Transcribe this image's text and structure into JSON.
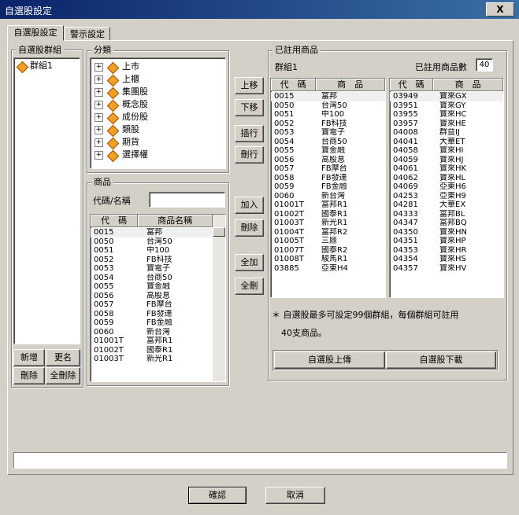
{
  "window": {
    "title": "自選股設定",
    "close": "X"
  },
  "tabs": [
    {
      "label": "自選股設定"
    },
    {
      "label": "警示設定"
    }
  ],
  "groups_panel": {
    "label": "自選股群組",
    "items": [
      "群組1"
    ],
    "buttons": {
      "add": "新增",
      "rename": "更名",
      "delete": "刪除",
      "delete_all": "全刪除"
    }
  },
  "category_panel": {
    "label": "分類",
    "items": [
      "上市",
      "上櫃",
      "集團股",
      "概念股",
      "成份股",
      "類股",
      "期貨",
      "選擇權"
    ]
  },
  "product_panel": {
    "label": "商品",
    "search_label": "代碼/名稱",
    "search_value": "",
    "columns": [
      "代　碼",
      "商品名稱"
    ],
    "rows": [
      [
        "0015",
        "富邦"
      ],
      [
        "0050",
        "台灣50"
      ],
      [
        "0051",
        "中100"
      ],
      [
        "0052",
        "FB科技"
      ],
      [
        "0053",
        "寶電子"
      ],
      [
        "0054",
        "台商50"
      ],
      [
        "0055",
        "寶金融"
      ],
      [
        "0056",
        "高股息"
      ],
      [
        "0057",
        "FB摩台"
      ],
      [
        "0058",
        "FB發達"
      ],
      [
        "0059",
        "FB金融"
      ],
      [
        "0060",
        "新台灣"
      ],
      [
        "01001T",
        "富邦R1"
      ],
      [
        "01002T",
        "國泰R1"
      ],
      [
        "01003T",
        "新光R1"
      ]
    ]
  },
  "middle_buttons": {
    "up": "上移",
    "down": "下移",
    "insert": "插行",
    "delete_row": "刪行",
    "add": "加入",
    "remove": "刪除",
    "add_all": "全加",
    "remove_all": "全刪"
  },
  "used_panel": {
    "label": "已註用商品",
    "group_name": "群組1",
    "count_label": "已註用商品數",
    "count": "40",
    "columns": [
      "代　碼",
      "商　品"
    ],
    "left_rows": [
      [
        "0015",
        "富邦"
      ],
      [
        "0050",
        "台灣50"
      ],
      [
        "0051",
        "中100"
      ],
      [
        "0052",
        "FB科技"
      ],
      [
        "0053",
        "寶電子"
      ],
      [
        "0054",
        "台商50"
      ],
      [
        "0055",
        "寶金融"
      ],
      [
        "0056",
        "高股息"
      ],
      [
        "0057",
        "FB摩台"
      ],
      [
        "0058",
        "FB發達"
      ],
      [
        "0059",
        "FB金融"
      ],
      [
        "0060",
        "新台灣"
      ],
      [
        "01001T",
        "富邦R1"
      ],
      [
        "01002T",
        "國泰R1"
      ],
      [
        "01003T",
        "新光R1"
      ],
      [
        "01004T",
        "富邦R2"
      ],
      [
        "01005T",
        "三鼎"
      ],
      [
        "01007T",
        "國泰R2"
      ],
      [
        "01008T",
        "駿馬R1"
      ],
      [
        "03885",
        "亞東H4"
      ]
    ],
    "right_rows": [
      [
        "03949",
        "寶來GX"
      ],
      [
        "03951",
        "寶來GY"
      ],
      [
        "03955",
        "寶來HC"
      ],
      [
        "03957",
        "寶來HE"
      ],
      [
        "04008",
        "群益IJ"
      ],
      [
        "04041",
        "大華ET"
      ],
      [
        "04058",
        "寶來HI"
      ],
      [
        "04059",
        "寶來HJ"
      ],
      [
        "04061",
        "寶來HK"
      ],
      [
        "04062",
        "寶來HL"
      ],
      [
        "04069",
        "亞東H6"
      ],
      [
        "04253",
        "亞東H9"
      ],
      [
        "04281",
        "大華EX"
      ],
      [
        "04333",
        "富邦BL"
      ],
      [
        "04347",
        "富邦BQ"
      ],
      [
        "04350",
        "寶來HN"
      ],
      [
        "04351",
        "寶來HP"
      ],
      [
        "04353",
        "寶來HR"
      ],
      [
        "04354",
        "寶來HS"
      ],
      [
        "04357",
        "寶來HV"
      ]
    ],
    "note_line1": "＊ 自選股最多可設定99個群組，每個群組可註用",
    "note_line2": "40支商品。",
    "upload": "自選股上傳",
    "download": "自選股下載"
  },
  "footer": {
    "status": "",
    "ok": "確認",
    "cancel": "取消"
  }
}
